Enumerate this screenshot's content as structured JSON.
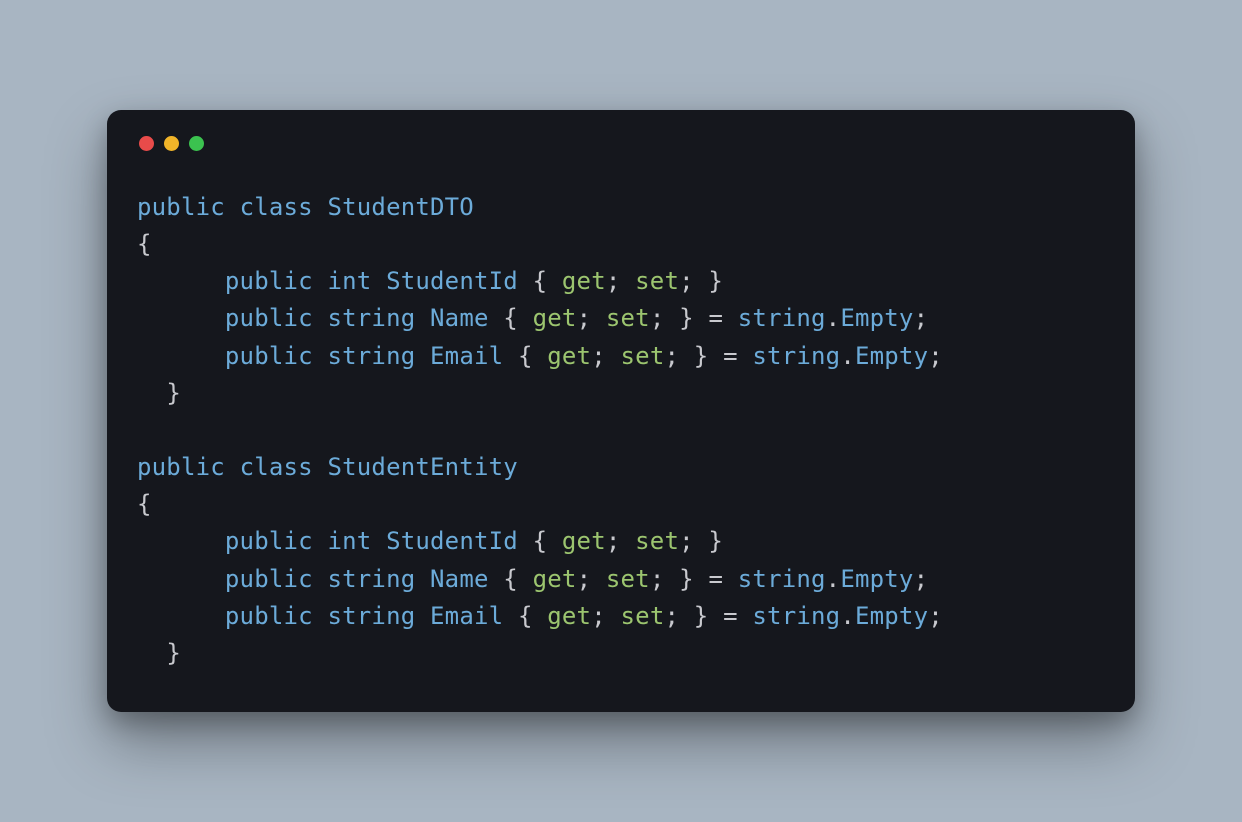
{
  "colors": {
    "bg_page": "#a8b5c2",
    "bg_window": "#15171d",
    "keyword": "#6cabd9",
    "type": "#6cabd9",
    "identifier": "#6cabd9",
    "accessor": "#9cc56f",
    "punct": "#c8c9ce",
    "traffic_red": "#e84b4a",
    "traffic_yellow": "#f0b429",
    "traffic_green": "#3bc24f"
  },
  "tokens": {
    "public": "public",
    "class": "class",
    "int": "int",
    "string": "string",
    "get": "get",
    "set": "set",
    "empty": "Empty",
    "lbrace": "{",
    "rbrace": "}",
    "eq": "=",
    "semi": ";",
    "dot": "."
  },
  "class1": {
    "name": "StudentDTO",
    "prop1": "StudentId",
    "prop2": "Name",
    "prop3": "Email"
  },
  "class2": {
    "name": "StudentEntity",
    "prop1": "StudentId",
    "prop2": "Name",
    "prop3": "Email"
  }
}
